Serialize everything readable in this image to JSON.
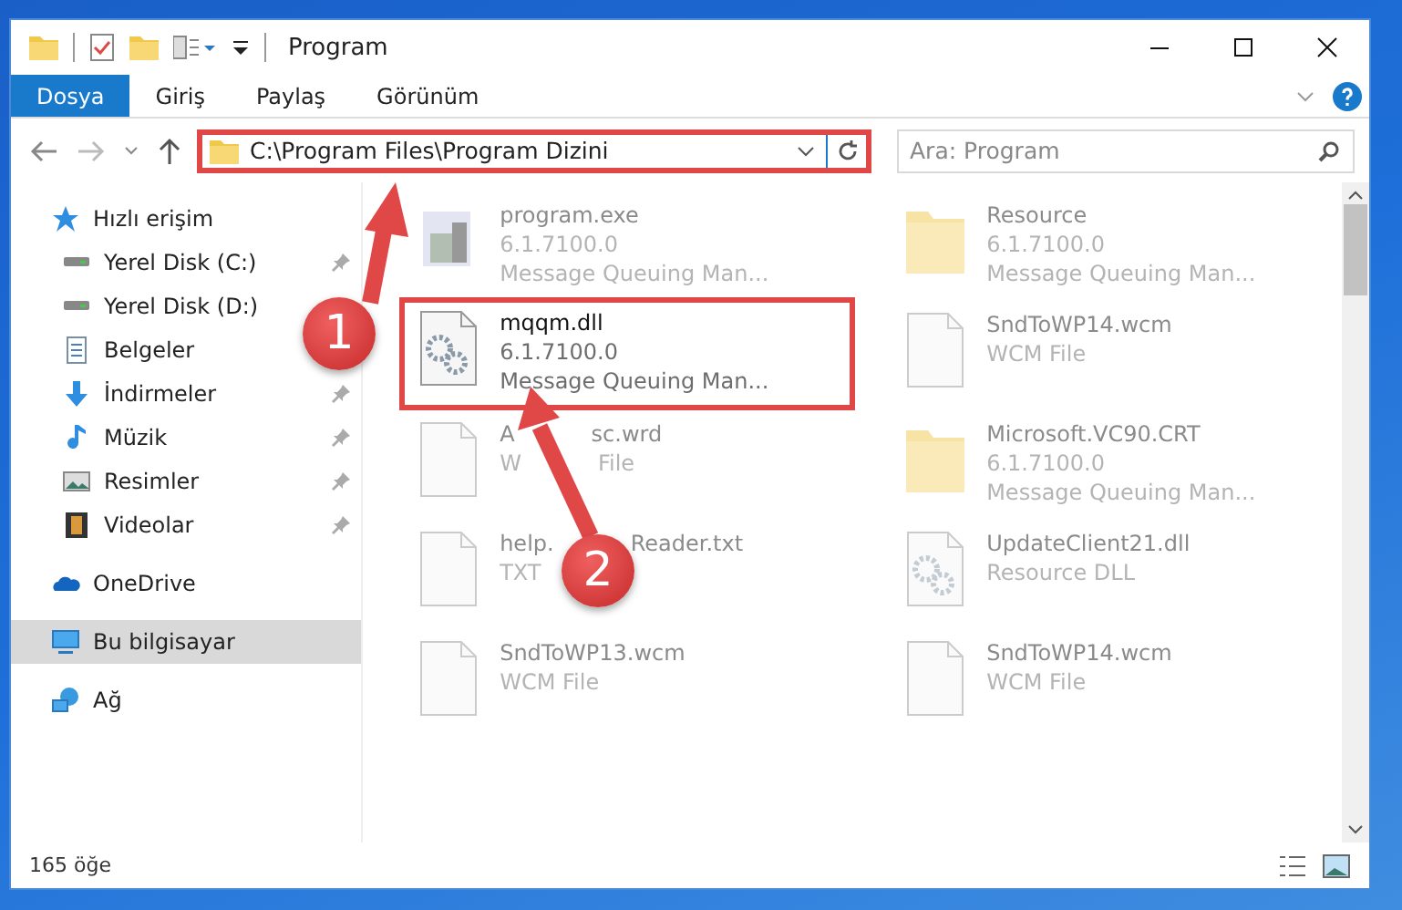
{
  "window": {
    "title": "Program"
  },
  "ribbon_tabs": [
    {
      "label": "Dosya",
      "selected": true
    },
    {
      "label": "Giriş",
      "selected": false
    },
    {
      "label": "Paylaş",
      "selected": false
    },
    {
      "label": "Görünüm",
      "selected": false
    }
  ],
  "address_bar": {
    "path": "C:\\Program Files\\Program Dizini",
    "highlighted": true
  },
  "search": {
    "placeholder": "Ara: Program"
  },
  "sidebar": {
    "items": [
      {
        "label": "Hızlı erişim",
        "kind": "star",
        "selected": false,
        "children": [
          {
            "label": "Yerel Disk (C:)",
            "kind": "drive",
            "pinned": true,
            "selected": false
          },
          {
            "label": "Yerel Disk (D:)",
            "kind": "drive",
            "pinned": false,
            "selected": false
          },
          {
            "label": "Belgeler",
            "kind": "docs",
            "pinned": false,
            "selected": false
          },
          {
            "label": "İndirmeler",
            "kind": "download",
            "pinned": true,
            "selected": false
          },
          {
            "label": "Müzik",
            "kind": "music",
            "pinned": true,
            "selected": false
          },
          {
            "label": "Resimler",
            "kind": "pictures",
            "pinned": true,
            "selected": false
          },
          {
            "label": "Videolar",
            "kind": "video",
            "pinned": true,
            "selected": false
          }
        ]
      },
      {
        "label": "OneDrive",
        "kind": "cloud",
        "selected": false
      },
      {
        "label": "Bu bilgisayar",
        "kind": "pc",
        "selected": true
      },
      {
        "label": "Ağ",
        "kind": "network",
        "selected": false
      }
    ]
  },
  "files": [
    {
      "name": "program.exe",
      "kind": "exe",
      "details": [
        "6.1.7100.0",
        "Message Queuing Man..."
      ],
      "highlighted": false
    },
    {
      "name": "Resource",
      "kind": "folder",
      "details": [
        "6.1.7100.0",
        "Message Queuing Man..."
      ],
      "highlighted": false
    },
    {
      "name": "mqqm.dll",
      "kind": "dll",
      "details": [
        "6.1.7100.0",
        "Message Queuing Man..."
      ],
      "highlighted": true
    },
    {
      "name": "SndToWP14.wcm",
      "kind": "doc",
      "details": [
        "WCM File"
      ],
      "highlighted": false
    },
    {
      "name": [
        "A",
        "sc.wrd"
      ],
      "kind": "doc",
      "details": [
        [
          "W",
          "File"
        ]
      ],
      "partly_covered": true,
      "highlighted": false
    },
    {
      "name": "Microsoft.VC90.CRT",
      "kind": "folder",
      "details": [
        "6.1.7100.0",
        "Message Queuing Man..."
      ],
      "highlighted": false
    },
    {
      "name": [
        "help.",
        "Reader.txt"
      ],
      "kind": "doc",
      "details": [
        "TXT"
      ],
      "partly_covered": true,
      "highlighted": false
    },
    {
      "name": "UpdateClient21.dll",
      "kind": "dll",
      "details": [
        "Resource DLL"
      ],
      "highlighted": false
    },
    {
      "name": "SndToWP13.wcm",
      "kind": "doc",
      "details": [
        "WCM File"
      ],
      "highlighted": false
    },
    {
      "name": "SndToWP14.wcm",
      "kind": "doc",
      "details": [
        "WCM File"
      ],
      "highlighted": false
    }
  ],
  "status_bar": {
    "item_count": "165 öğe"
  },
  "annotations": [
    {
      "number": "1"
    },
    {
      "number": "2"
    }
  ]
}
